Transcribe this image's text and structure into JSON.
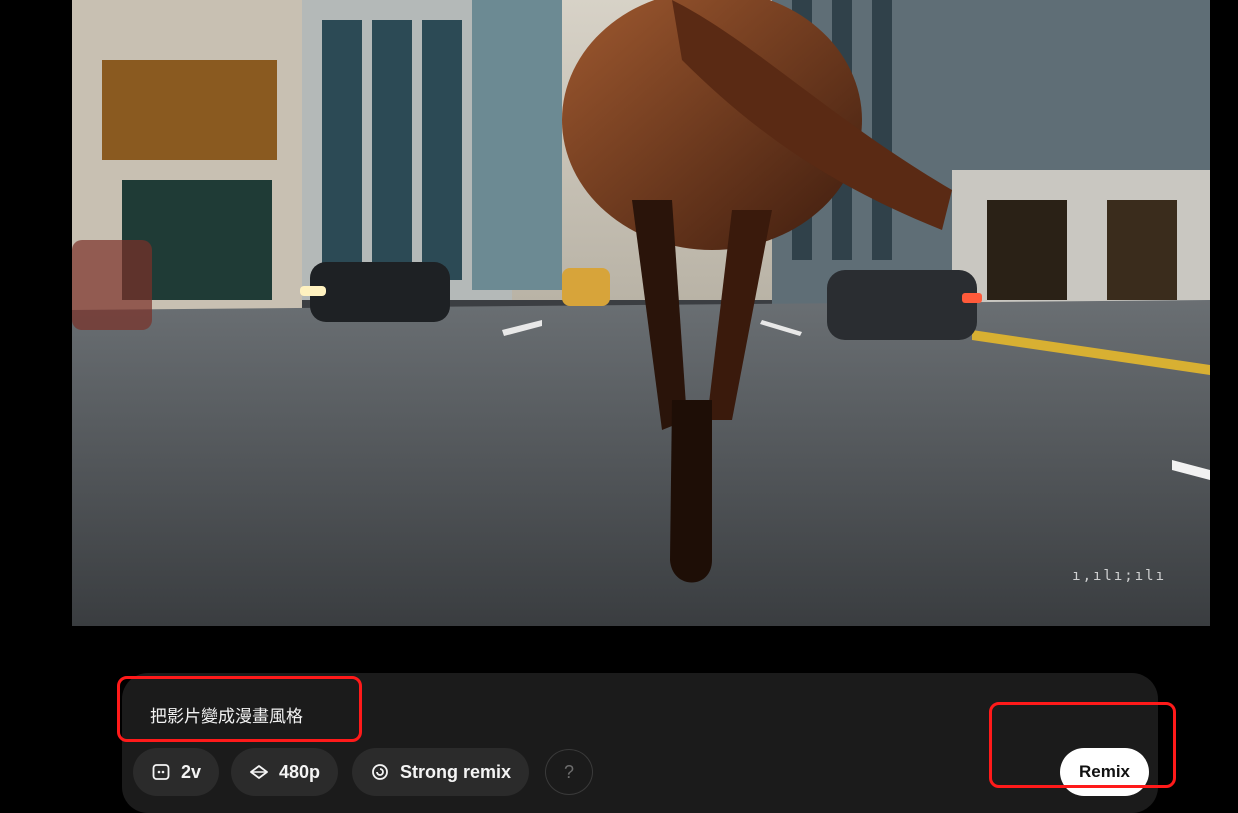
{
  "video": {
    "watermark": "ı,ılı;ılı"
  },
  "composer": {
    "prompt": "把影片變成漫畫風格",
    "options": [
      {
        "icon": "chat-icon",
        "label": "2v"
      },
      {
        "icon": "diamond-icon",
        "label": "480p"
      },
      {
        "icon": "spiral-icon",
        "label": "Strong remix"
      }
    ],
    "help_label": "?",
    "submit_label": "Remix"
  },
  "colors": {
    "highlight": "#ff1a1a",
    "panel": "#1b1b1b",
    "chip": "#2b2b2b"
  }
}
